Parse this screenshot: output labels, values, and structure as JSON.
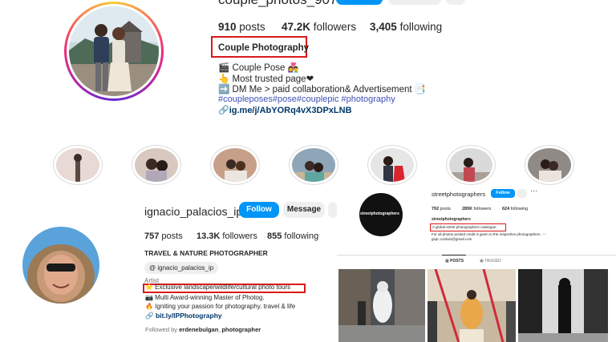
{
  "profile1": {
    "username": "couple_photos_907",
    "posts_count": "910",
    "posts_label": "posts",
    "followers_count": "47.2K",
    "followers_label": "followers",
    "following_count": "3,405",
    "following_label": "following",
    "name": "Couple Photography",
    "bio_line1": "🎬 Couple Pose 👩‍❤️‍👨",
    "bio_line2": "👆 Most trusted page❤",
    "bio_line3": "➡️ DM Me > paid collaboration& Advertisement 📑",
    "bio_hashtags": "#coupleposes#pose#couplepic #photography",
    "link": "ig.me/j/AbYORq4vX3DPxLNB"
  },
  "profile2": {
    "username": "ignacio_palacios_ip",
    "follow_label": "Follow",
    "message_label": "Message",
    "posts_count": "757",
    "posts_label": "posts",
    "followers_count": "13.3K",
    "followers_label": "followers",
    "following_count": "855",
    "following_label": "following",
    "name": "TRAVEL & NATURE PHOTOGRAPHER",
    "threads_handle": "ignacio_palacios_ip",
    "category": "Artist",
    "bio_line1": "⭐ Exclusive landscape/wildlife/cultural photo tours",
    "bio_line2": "📷 Multi Award-winning Master of Photog.",
    "bio_line3": "🔥 Igniting your passion for photography. travel & life",
    "link": "bit.ly/IPPhotography",
    "followed_by_prefix": "Followed by ",
    "followed_by_user": "erdenebulgan_photographer"
  },
  "profile3": {
    "username": "streetphotographers",
    "follow_label": "Follow",
    "avatar_text": "streetphotographers",
    "posts_count": "792",
    "posts_label": "posts",
    "followers_count": "285K",
    "followers_label": "followers",
    "following_count": "624",
    "following_label": "following",
    "name": "streetphotographers",
    "bio_line1": "A global street photographers catalogue.",
    "bio_line2": "For all photos posted credit is given to the respective photographers. 📨",
    "bio_line3": "gspc.contact@gmail.com",
    "tab_posts": "POSTS",
    "tab_tagged": "TAGGED"
  }
}
